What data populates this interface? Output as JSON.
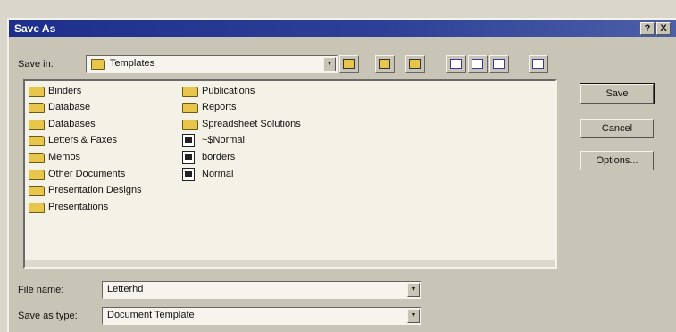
{
  "window": {
    "title": "Save As",
    "help_label": "?",
    "close_label": "X"
  },
  "save_in": {
    "label": "Save in:",
    "value": "Templates"
  },
  "toolbar": {
    "icons": [
      "up-one-level-icon",
      "desktop-icon",
      "new-folder-icon",
      "list-view-icon",
      "details-view-icon",
      "properties-view-icon",
      "commands-icon"
    ]
  },
  "file_list": {
    "items": [
      {
        "name": "Binders",
        "type": "folder"
      },
      {
        "name": "Database",
        "type": "folder"
      },
      {
        "name": "Databases",
        "type": "folder"
      },
      {
        "name": "Letters & Faxes",
        "type": "folder"
      },
      {
        "name": "Memos",
        "type": "folder"
      },
      {
        "name": "Other Documents",
        "type": "folder"
      },
      {
        "name": "Presentation Designs",
        "type": "folder"
      },
      {
        "name": "Presentations",
        "type": "folder"
      },
      {
        "name": "Publications",
        "type": "folder"
      },
      {
        "name": "Reports",
        "type": "folder"
      },
      {
        "name": "Spreadsheet Solutions",
        "type": "folder"
      },
      {
        "name": "~$Normal",
        "type": "document"
      },
      {
        "name": "borders",
        "type": "document"
      },
      {
        "name": "Normal",
        "type": "document"
      }
    ]
  },
  "buttons": {
    "save": "Save",
    "cancel": "Cancel",
    "options": "Options..."
  },
  "file_name": {
    "label": "File name:",
    "value": "Letterhd"
  },
  "save_as_type": {
    "label": "Save as type:",
    "value": "Document Template"
  }
}
